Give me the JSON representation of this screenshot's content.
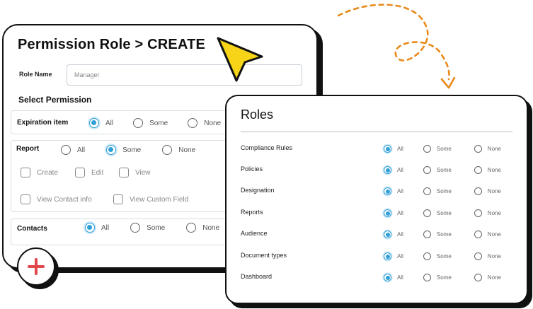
{
  "permission_role": {
    "title": "Permission Role > CREATE",
    "role_name_label": "Role Name",
    "role_name_placeholder": "Manager",
    "select_permission": "Select Permission",
    "expiration": {
      "name": "Expiration item",
      "options": [
        "All",
        "Some",
        "None"
      ],
      "selected": "All"
    },
    "report": {
      "name": "Report",
      "options": [
        "All",
        "Some",
        "None"
      ],
      "selected": "Some",
      "checks": [
        "Create",
        "Edit",
        "View",
        "View Contact info",
        "View Custom Field"
      ]
    },
    "contacts": {
      "name": "Contacts",
      "options": [
        "All",
        "Some",
        "None"
      ],
      "selected": "All"
    }
  },
  "roles": {
    "title": "Roles",
    "options": [
      "All",
      "Some",
      "None"
    ],
    "rows": [
      {
        "label": "Compliance Rules",
        "selected": "All"
      },
      {
        "label": "Policies",
        "selected": "All"
      },
      {
        "label": "Designation",
        "selected": "All"
      },
      {
        "label": "Reports",
        "selected": "All"
      },
      {
        "label": "Audience",
        "selected": "All"
      },
      {
        "label": "Document types",
        "selected": "All"
      },
      {
        "label": "Dashboard",
        "selected": "All"
      }
    ]
  },
  "colors": {
    "accent": "#2f9fd8",
    "cursor": "#f7d417",
    "arrow": "#e88a1a",
    "plus": "#e0484c"
  },
  "icons": {
    "add": "plus-icon",
    "pointer": "cursor-arrow-icon",
    "decoration": "dashed-arrow-icon"
  }
}
